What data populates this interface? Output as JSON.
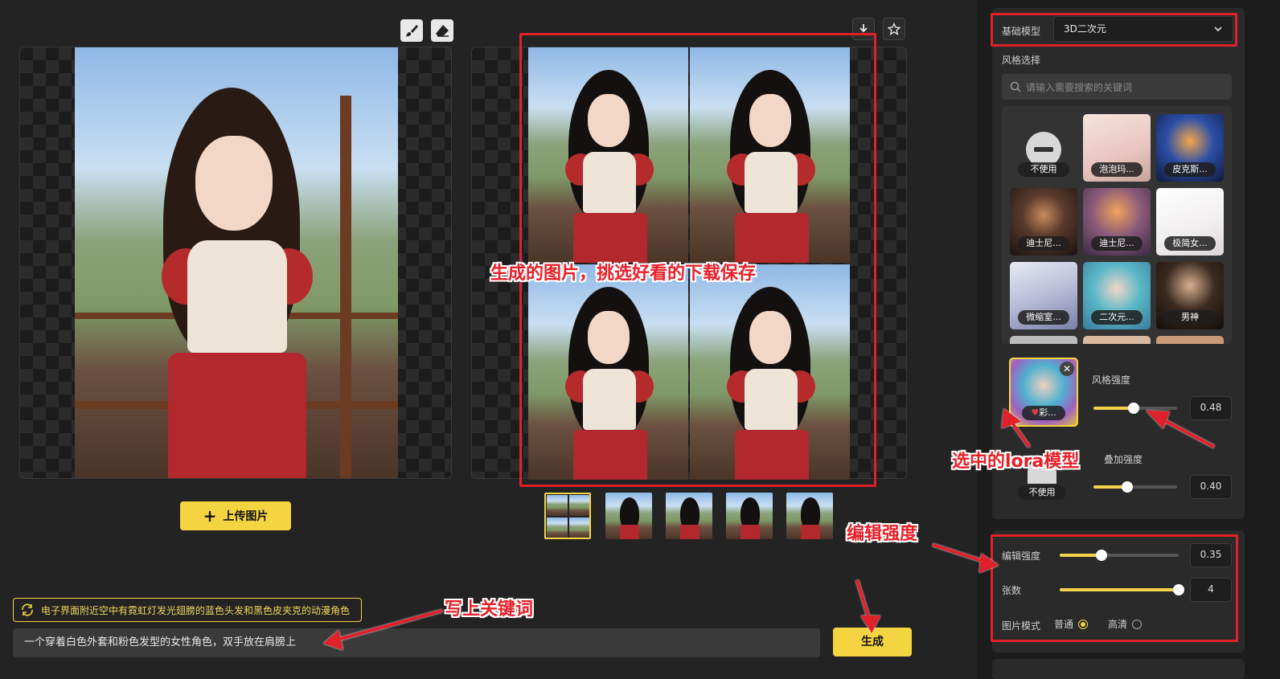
{
  "toolbar_left": {
    "brush_icon": "brush-icon",
    "eraser_icon": "eraser-icon"
  },
  "toolbar_right": {
    "download_icon": "download-icon",
    "star_icon": "star-icon"
  },
  "upload_button": {
    "label": "上传图片"
  },
  "suggestion": {
    "text": "电子界面附近空中有霓虹灯发光翅膀的蓝色头发和黑色皮夹克的动漫角色"
  },
  "prompt": {
    "value": "一个穿着白色外套和粉色发型的女性角色，双手放在肩膀上"
  },
  "generate_button": {
    "label": "生成"
  },
  "sidebar": {
    "base_model_label": "基础模型",
    "base_model_value": "3D二次元",
    "style_section_label": "风格选择",
    "search_placeholder": "请输入需要搜索的关键词",
    "styles": [
      {
        "label": "不使用"
      },
      {
        "label": "泡泡玛..."
      },
      {
        "label": "皮克斯..."
      },
      {
        "label": "迪士尼..."
      },
      {
        "label": "迪士尼..."
      },
      {
        "label": "极简女..."
      },
      {
        "label": "微缩室..."
      },
      {
        "label": "二次元..."
      },
      {
        "label": "男神"
      }
    ],
    "selected_lora_label": "彩...",
    "style_strength_label": "风格强度",
    "style_strength_value": "0.48",
    "style_strength_fraction": 0.48,
    "overlay_label_partial": "叠加强度",
    "overlay_none_label": "不使用",
    "overlay_value": "0.40",
    "overlay_fraction": 0.4,
    "edit_strength_label": "编辑强度",
    "edit_strength_value": "0.35",
    "edit_strength_fraction": 0.35,
    "count_label": "张数",
    "count_value": "4",
    "count_fraction": 1.0,
    "image_mode_label": "图片模式",
    "mode_normal": "普通",
    "mode_hd": "高清"
  },
  "annotations": {
    "generated": "生成的图片，挑选好看的下载保存",
    "lora": "选中的lora模型",
    "edit_strength": "编辑强度",
    "keywords": "写上关键词"
  },
  "colors": {
    "accent": "#f5d442",
    "annotation": "#e0202a",
    "bg": "#232323"
  }
}
